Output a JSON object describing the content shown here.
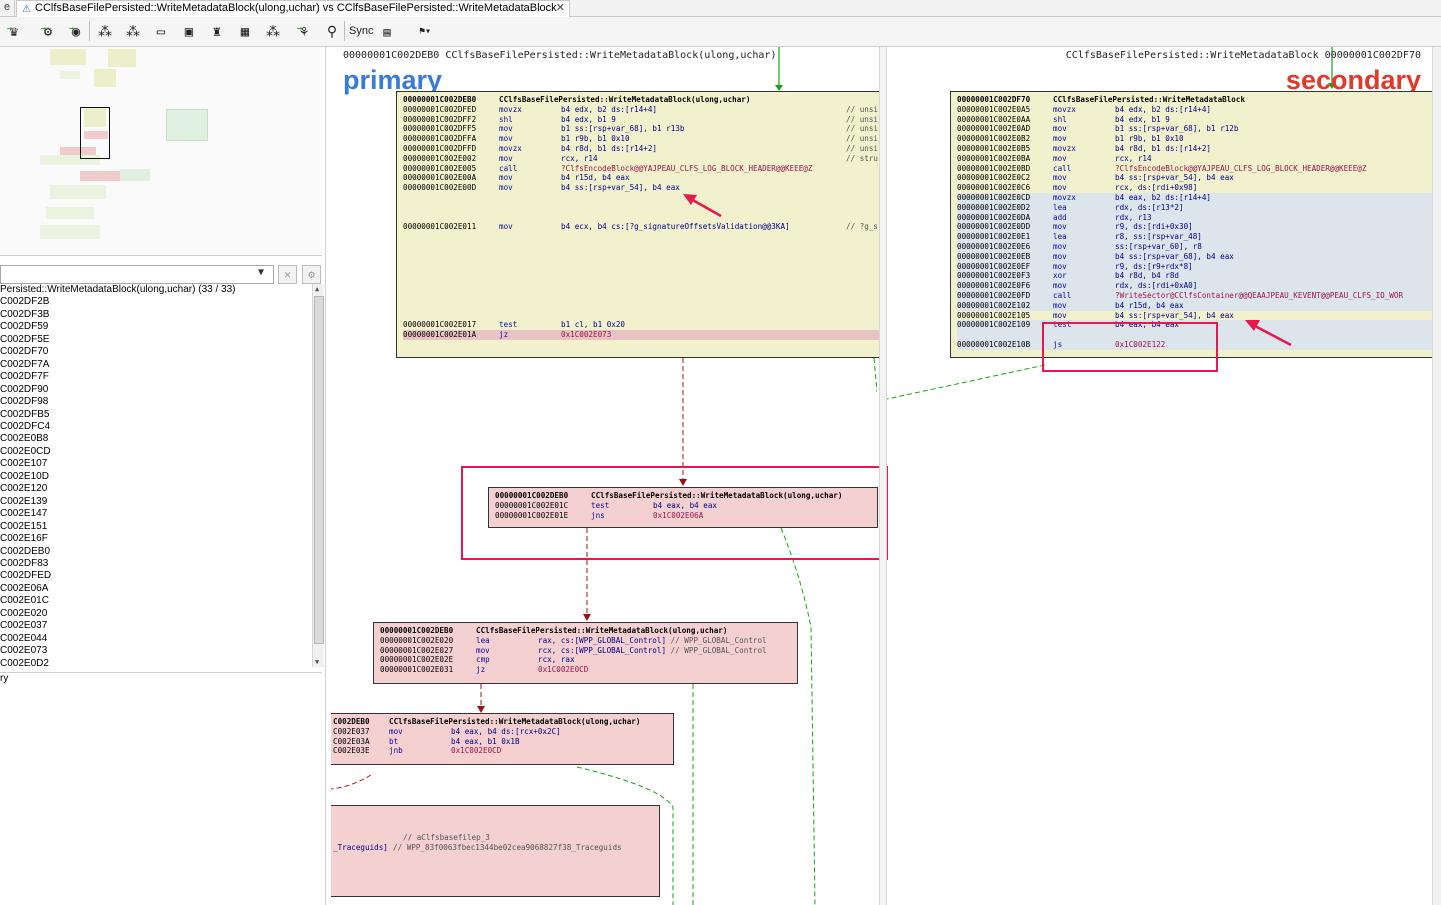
{
  "tab": {
    "stub": "e",
    "title": "CClfsBaseFilePersisted::WriteMetadataBlock(ulong,uchar) vs CClfsBaseFilePersisted::WriteMetadataBlock"
  },
  "toolbar": {
    "sync_label": "Sync",
    "icons": [
      "diff-graph-icon",
      "node-select-icon",
      "hierarchy-icon",
      "radial-layout-icon",
      "circular-layout-icon",
      "grid-layout-icon",
      "orthogonal-layout-icon",
      "tree-layout-icon",
      "flow-layout-icon",
      "zoom-icon",
      "compare-icon",
      "proximity-icon",
      "sync-icon"
    ]
  },
  "left": {
    "list_header": "Persisted::WriteMetadataBlock(ulong,uchar) (33 / 33)",
    "items": [
      "C002DF2B",
      "C002DF3B",
      "C002DF59",
      "C002DF5E",
      "C002DF70",
      "C002DF7A",
      "C002DF7F",
      "C002DF90",
      "C002DF98",
      "C002DFB5",
      "C002DFC4",
      "C002E0B8",
      "C002E0CD",
      "C002E107",
      "C002E10D",
      "C002E120",
      "C002E139",
      "C002E147",
      "C002E151",
      "C002E16F",
      "C002DEB0",
      "C002DF83",
      "C002DFED",
      "C002E06A",
      "C002E01C",
      "C002E020",
      "C002E037",
      "C002E044",
      "C002E073",
      "C002E0D2"
    ],
    "bottom_label": "ry"
  },
  "primary": {
    "header": "00000001C002DEB0 CClfsBaseFilePersisted::WriteMetadataBlock(ulong,uchar)",
    "label": "primary",
    "label_color": "#3a7bd5",
    "block1": {
      "title_addr": "00000001C002DEB0",
      "title": "CClfsBaseFilePersisted::WriteMetadataBlock(ulong,uchar)",
      "rows": [
        {
          "a": "00000001C002DFED",
          "m": "movzx",
          "o": "b4 edx, b2 ds:[r14+4]",
          "c": "// unsi"
        },
        {
          "a": "00000001C002DFF2",
          "m": "shl",
          "o": "b4 edx, b1 9",
          "c": "// unsi"
        },
        {
          "a": "00000001C002DFF5",
          "m": "mov",
          "o": "b1 ss:[rsp+var_68], b1 r13b",
          "c": "// unsi"
        },
        {
          "a": "00000001C002DFFA",
          "m": "mov",
          "o": "b1 r9b, b1 0x10",
          "c": "// unsi"
        },
        {
          "a": "00000001C002DFFD",
          "m": "movzx",
          "o": "b4 r8d, b1 ds:[r14+2]",
          "c": "// unsi"
        },
        {
          "a": "00000001C002E002",
          "m": "mov",
          "o": "rcx, r14",
          "c": "// stru"
        },
        {
          "a": "00000001C002E005",
          "m": "call",
          "o": "?ClfsEncodeBlock@@YAJPEAU_CLFS_LOG_BLOCK_HEADER@@KEEE@Z",
          "c": ""
        },
        {
          "a": "00000001C002E00A",
          "m": "mov",
          "o": "b4 r15d, b4 eax",
          "c": ""
        },
        {
          "a": "00000001C002E00D",
          "m": "mov",
          "o": "b4 ss:[rsp+var_54], b4 eax",
          "c": ""
        },
        {
          "a": "",
          "m": "",
          "o": "",
          "c": ""
        },
        {
          "a": "",
          "m": "",
          "o": "",
          "c": ""
        },
        {
          "a": "",
          "m": "",
          "o": "",
          "c": ""
        },
        {
          "a": "00000001C002E011",
          "m": "mov",
          "o": "b4 ecx, b4 cs:[?g_signatureOffsetsValidation@@3KA]",
          "c": "// ?g_s"
        }
      ],
      "tail": [
        {
          "a": "00000001C002E017",
          "m": "test",
          "o": "b1 cl, b1 0x20",
          "c": ""
        },
        {
          "a": "00000001C002E01A",
          "m": "jz",
          "o": "0x1C002E073",
          "c": ""
        }
      ]
    },
    "block2": {
      "title_addr": "00000001C002DEB0",
      "title": "CClfsBaseFilePersisted::WriteMetadataBlock(ulong,uchar)",
      "rows": [
        {
          "a": "00000001C002E01C",
          "m": "test",
          "o": "b4 eax, b4 eax",
          "c": ""
        },
        {
          "a": "00000001C002E01E",
          "m": "jns",
          "o": "0x1C002E06A",
          "c": ""
        }
      ]
    },
    "block3": {
      "title_addr": "00000001C002DEB0",
      "title": "CClfsBaseFilePersisted::WriteMetadataBlock(ulong,uchar)",
      "rows": [
        {
          "a": "00000001C002E020",
          "m": "lea",
          "o": "rax, cs:[WPP_GLOBAL_Control]",
          "c": "// WPP_GLOBAL_Control"
        },
        {
          "a": "00000001C002E027",
          "m": "mov",
          "o": "rcx, cs:[WPP_GLOBAL_Control]",
          "c": "// WPP_GLOBAL_Control"
        },
        {
          "a": "00000001C002E02E",
          "m": "cmp",
          "o": "rcx, rax",
          "c": ""
        },
        {
          "a": "00000001C002E031",
          "m": "jz",
          "o": "0x1C002E0CD",
          "c": ""
        }
      ]
    },
    "block4": {
      "title_addr": "C002DEB0",
      "title": "CClfsBaseFilePersisted::WriteMetadataBlock(ulong,uchar)",
      "rows": [
        {
          "a": "C002E037",
          "m": "mov",
          "o": "b4 eax, b4 ds:[rcx+0x2C]",
          "c": ""
        },
        {
          "a": "C002E03A",
          "m": "bt",
          "o": "b4 eax, b1 0x1B",
          "c": ""
        },
        {
          "a": "C002E03E",
          "m": "jnb",
          "o": "0x1C002E0CD",
          "c": ""
        }
      ]
    },
    "block5": {
      "rows": [
        {
          "a": "",
          "m": "",
          "o": "",
          "c": "// aClfsbasefilep_3"
        },
        {
          "a": "_Traceguids]",
          "m": "",
          "o": "",
          "c": "// WPP_83f0063fbec1344be02cea9068827f38_Traceguids"
        }
      ]
    }
  },
  "secondary": {
    "header": "CClfsBaseFilePersisted::WriteMetadataBlock 00000001C002DF70",
    "label": "secondary",
    "label_color": "#e03a2a",
    "block1": {
      "title_addr": "00000001C002DF70",
      "title": "CClfsBaseFilePersisted::WriteMetadataBlock",
      "rows": [
        {
          "a": "00000001C002E0A5",
          "m": "movzx",
          "o": "b4 edx, b2 ds:[r14+4]"
        },
        {
          "a": "00000001C002E0AA",
          "m": "shl",
          "o": "b4 edx, b1 9"
        },
        {
          "a": "00000001C002E0AD",
          "m": "mov",
          "o": "b1 ss:[rsp+var_68], b1 r12b"
        },
        {
          "a": "00000001C002E0B2",
          "m": "mov",
          "o": "b1 r9b, b1 0x10"
        },
        {
          "a": "00000001C002E0B5",
          "m": "movzx",
          "o": "b4 r8d, b1 ds:[r14+2]"
        },
        {
          "a": "00000001C002E0BA",
          "m": "mov",
          "o": "rcx, r14"
        },
        {
          "a": "00000001C002E0BD",
          "m": "call",
          "o": "?ClfsEncodeBlock@@YAJPEAU_CLFS_LOG_BLOCK_HEADER@@KEEE@Z"
        },
        {
          "a": "00000001C002E0C2",
          "m": "mov",
          "o": "b4 ss:[rsp+var_54], b4 eax"
        },
        {
          "a": "00000001C002E0C6",
          "m": "mov",
          "o": "rcx, ds:[rdi+0x98]"
        },
        {
          "a": "00000001C002E0CD",
          "m": "movzx",
          "o": "b4 eax, b2 ds:[r14+4]"
        },
        {
          "a": "00000001C002E0D2",
          "m": "lea",
          "o": "rdx, ds:[r13*2]"
        },
        {
          "a": "00000001C002E0DA",
          "m": "add",
          "o": "rdx, r13"
        },
        {
          "a": "00000001C002E0DD",
          "m": "mov",
          "o": "r9, ds:[rdi+0x30]"
        },
        {
          "a": "00000001C002E0E1",
          "m": "lea",
          "o": "r8, ss:[rsp+var_48]"
        },
        {
          "a": "00000001C002E0E6",
          "m": "mov",
          "o": "ss:[rsp+var_60], r8"
        },
        {
          "a": "00000001C002E0EB",
          "m": "mov",
          "o": "b4 ss:[rsp+var_68], b4 eax"
        },
        {
          "a": "00000001C002E0EF",
          "m": "mov",
          "o": "r9, ds:[r9+rdx*8]"
        },
        {
          "a": "00000001C002E0F3",
          "m": "xor",
          "o": "b4 r8d, b4 r8d"
        },
        {
          "a": "00000001C002E0F6",
          "m": "mov",
          "o": "rdx, ds:[rdi+0xA0]"
        },
        {
          "a": "00000001C002E0FD",
          "m": "call",
          "o": "?WriteSector@CClfsContainer@@QEAAJPEAU_KEVENT@@PEAU_CLFS_IO_WOR"
        },
        {
          "a": "00000001C002E102",
          "m": "mov",
          "o": "b4 r15d, b4 eax"
        },
        {
          "a": "00000001C002E105",
          "m": "mov",
          "o": "b4 ss:[rsp+var_54], b4 eax"
        },
        {
          "a": "00000001C002E109",
          "m": "test",
          "o": "b4 eax, b4 eax"
        },
        {
          "a": "",
          "m": "",
          "o": ""
        },
        {
          "a": "00000001C002E10B",
          "m": "js",
          "o": "0x1C002E122"
        }
      ]
    }
  }
}
